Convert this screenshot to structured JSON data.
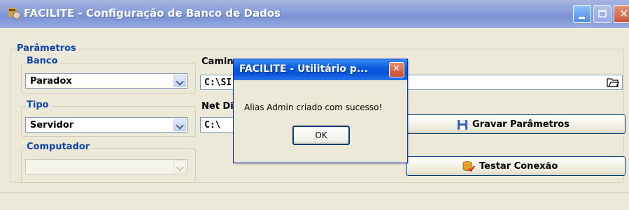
{
  "window": {
    "title": "FACILITE - Configuração de Banco de Dados",
    "title_color": "#ffffff"
  },
  "parametros": {
    "group_label": "Parâmetros",
    "banco": {
      "label": "Banco",
      "value": "Paradox"
    },
    "tipo": {
      "label": "Tipo",
      "value": "Servidor"
    },
    "computador": {
      "label": "Computador",
      "value": ""
    },
    "caminho": {
      "label": "Camin",
      "value": "C:\\SI"
    },
    "net_dir": {
      "label": "Net Di",
      "value": "C:\\"
    }
  },
  "buttons": {
    "gravar": "Gravar Parâmetros",
    "testar": "Testar Conexão"
  },
  "dialog": {
    "title": "FACILITE - Utilitário p...",
    "message": "Alias Admin criado com sucesso!",
    "ok": "OK"
  },
  "colors": {
    "accent": "#1144a8",
    "dialog_titlebar": "#0a5be0",
    "window_bg": "#ece9d8"
  },
  "icons": [
    "app-icon",
    "folder-open-icon",
    "floppy-disk-icon",
    "database-check-icon"
  ]
}
